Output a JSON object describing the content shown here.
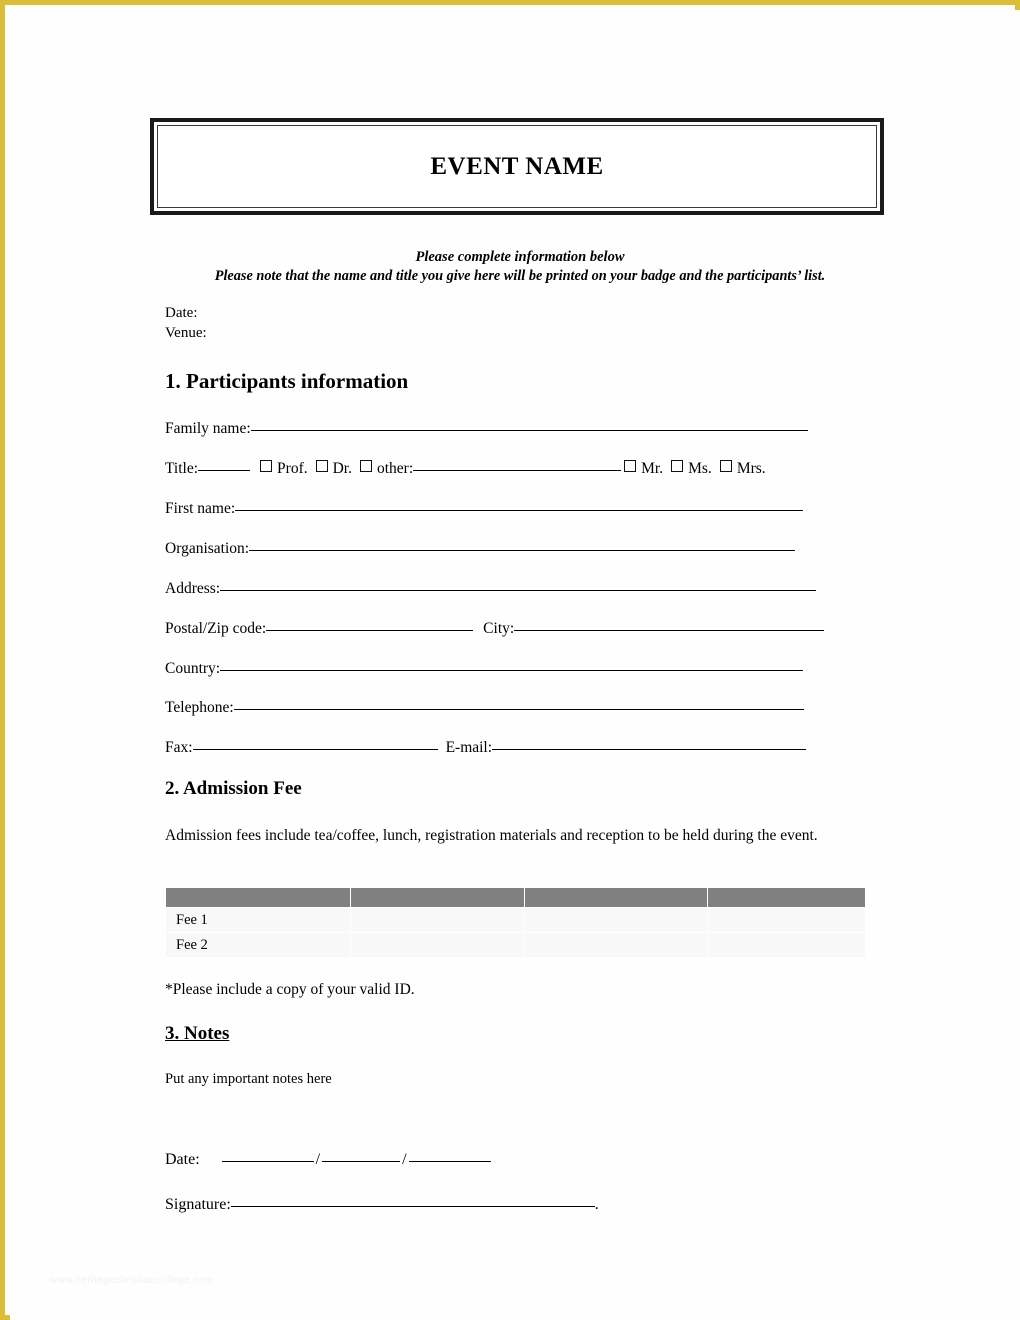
{
  "page": {
    "border_color": "#dbbe35",
    "background": "#fefefe",
    "watermark": "www.heritagechristiancollege.com"
  },
  "header": {
    "title": "EVENT NAME",
    "subtitle_line1": "Please complete information below",
    "subtitle_line2": "Please note that the name and title you give here will be printed on your badge and the participants’ list."
  },
  "meta": {
    "date_label": "Date:",
    "venue_label": "Venue:"
  },
  "sections": {
    "participants": {
      "heading": "1. Participants information",
      "fields": {
        "family_name": "Family name:",
        "title": "Title:",
        "first_name": "First name:",
        "organisation": "Organisation:",
        "address": "Address:",
        "postal_code": "Postal/Zip code:",
        "city": "City:",
        "country": "Country:",
        "telephone": "Telephone:",
        "fax": "Fax:",
        "email": "E-mail:"
      },
      "title_options": [
        {
          "label": "Prof."
        },
        {
          "label": "Dr."
        },
        {
          "label": "other:"
        },
        {
          "label": "Mr."
        },
        {
          "label": "Ms."
        },
        {
          "label": "Mrs."
        }
      ]
    },
    "admission": {
      "heading": "2. Admission Fee",
      "description": "Admission fees include tea/coffee, lunch, registration materials and reception to be held during the event.",
      "id_note": "*Please include a copy of your valid ID.",
      "table": {
        "header_color": "#808080",
        "row_color": "#f8f8f8",
        "columns": [
          "",
          "",
          "",
          ""
        ],
        "rows": [
          [
            "Fee 1",
            "",
            "",
            ""
          ],
          [
            "Fee 2",
            "",
            "",
            ""
          ]
        ]
      }
    },
    "notes": {
      "heading": "3. Notes",
      "text": "Put any important notes here"
    }
  },
  "signoff": {
    "date_label": "Date:",
    "separator": "/",
    "signature_label": "Signature:",
    "signature_terminator": "."
  }
}
